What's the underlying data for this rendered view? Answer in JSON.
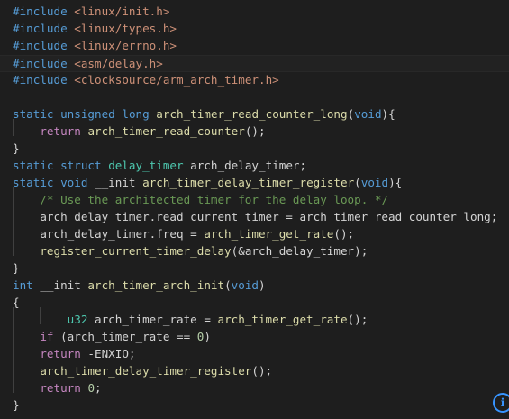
{
  "editor": {
    "lines": [
      {
        "tokens": [
          {
            "t": "#include",
            "c": "kw"
          },
          {
            "t": " ",
            "c": "pl"
          },
          {
            "t": "<linux/init.h>",
            "c": "str"
          }
        ]
      },
      {
        "tokens": [
          {
            "t": "#include",
            "c": "kw"
          },
          {
            "t": " ",
            "c": "pl"
          },
          {
            "t": "<linux/types.h>",
            "c": "str"
          }
        ]
      },
      {
        "tokens": [
          {
            "t": "#include",
            "c": "kw"
          },
          {
            "t": " ",
            "c": "pl"
          },
          {
            "t": "<linux/errno.h>",
            "c": "str"
          }
        ]
      },
      {
        "tokens": [
          {
            "t": "#include",
            "c": "kw"
          },
          {
            "t": " ",
            "c": "pl"
          },
          {
            "t": "<asm/delay.h>",
            "c": "str"
          }
        ],
        "current": true
      },
      {
        "tokens": [
          {
            "t": "#include",
            "c": "kw"
          },
          {
            "t": " ",
            "c": "pl"
          },
          {
            "t": "<clocksource/arm_arch_timer.h>",
            "c": "str"
          }
        ]
      },
      {
        "tokens": []
      },
      {
        "tokens": [
          {
            "t": "static",
            "c": "kw"
          },
          {
            "t": " ",
            "c": "pl"
          },
          {
            "t": "unsigned",
            "c": "kw"
          },
          {
            "t": " ",
            "c": "pl"
          },
          {
            "t": "long",
            "c": "kw"
          },
          {
            "t": " ",
            "c": "pl"
          },
          {
            "t": "arch_timer_read_counter_long",
            "c": "fn"
          },
          {
            "t": "(",
            "c": "pl"
          },
          {
            "t": "void",
            "c": "kw"
          },
          {
            "t": "){",
            "c": "pl"
          }
        ]
      },
      {
        "tokens": [
          {
            "t": "    ",
            "c": "pl"
          },
          {
            "t": "return",
            "c": "ctl"
          },
          {
            "t": " ",
            "c": "pl"
          },
          {
            "t": "arch_timer_read_counter",
            "c": "fn"
          },
          {
            "t": "();",
            "c": "pl"
          }
        ]
      },
      {
        "tokens": [
          {
            "t": "}",
            "c": "pl"
          }
        ]
      },
      {
        "tokens": [
          {
            "t": "static",
            "c": "kw"
          },
          {
            "t": " ",
            "c": "pl"
          },
          {
            "t": "struct",
            "c": "kw"
          },
          {
            "t": " ",
            "c": "pl"
          },
          {
            "t": "delay_timer",
            "c": "ty"
          },
          {
            "t": " arch_delay_timer;",
            "c": "pl"
          }
        ]
      },
      {
        "tokens": [
          {
            "t": "static",
            "c": "kw"
          },
          {
            "t": " ",
            "c": "pl"
          },
          {
            "t": "void",
            "c": "kw"
          },
          {
            "t": " __init ",
            "c": "pl"
          },
          {
            "t": "arch_timer_delay_timer_register",
            "c": "fn"
          },
          {
            "t": "(",
            "c": "pl"
          },
          {
            "t": "void",
            "c": "kw"
          },
          {
            "t": "){",
            "c": "pl"
          }
        ]
      },
      {
        "tokens": [
          {
            "t": "    ",
            "c": "pl"
          },
          {
            "t": "/* Use the architected timer for the delay loop. */",
            "c": "cm"
          }
        ]
      },
      {
        "tokens": [
          {
            "t": "    arch_delay_timer.read_current_timer = arch_timer_read_counter_long;",
            "c": "pl"
          }
        ]
      },
      {
        "tokens": [
          {
            "t": "    arch_delay_timer.freq = ",
            "c": "pl"
          },
          {
            "t": "arch_timer_get_rate",
            "c": "fn"
          },
          {
            "t": "();",
            "c": "pl"
          }
        ]
      },
      {
        "tokens": [
          {
            "t": "    ",
            "c": "pl"
          },
          {
            "t": "register_current_timer_delay",
            "c": "fn"
          },
          {
            "t": "(&arch_delay_timer);",
            "c": "pl"
          }
        ]
      },
      {
        "tokens": [
          {
            "t": "}",
            "c": "pl"
          }
        ]
      },
      {
        "tokens": [
          {
            "t": "int",
            "c": "kw"
          },
          {
            "t": " __init ",
            "c": "pl"
          },
          {
            "t": "arch_timer_arch_init",
            "c": "fn"
          },
          {
            "t": "(",
            "c": "pl"
          },
          {
            "t": "void",
            "c": "kw"
          },
          {
            "t": ")",
            "c": "pl"
          }
        ]
      },
      {
        "tokens": [
          {
            "t": "{",
            "c": "pl"
          }
        ]
      },
      {
        "tokens": [
          {
            "t": "        ",
            "c": "pl"
          },
          {
            "t": "u32",
            "c": "ty"
          },
          {
            "t": " arch_timer_rate = ",
            "c": "pl"
          },
          {
            "t": "arch_timer_get_rate",
            "c": "fn"
          },
          {
            "t": "();",
            "c": "pl"
          }
        ]
      },
      {
        "tokens": [
          {
            "t": "    ",
            "c": "pl"
          },
          {
            "t": "if",
            "c": "ctl"
          },
          {
            "t": " (arch_timer_rate == ",
            "c": "pl"
          },
          {
            "t": "0",
            "c": "num"
          },
          {
            "t": ")",
            "c": "pl"
          }
        ]
      },
      {
        "tokens": [
          {
            "t": "    ",
            "c": "pl"
          },
          {
            "t": "return",
            "c": "ctl"
          },
          {
            "t": " -ENXIO;",
            "c": "pl"
          }
        ]
      },
      {
        "tokens": [
          {
            "t": "    ",
            "c": "pl"
          },
          {
            "t": "arch_timer_delay_timer_register",
            "c": "fn"
          },
          {
            "t": "();",
            "c": "pl"
          }
        ]
      },
      {
        "tokens": [
          {
            "t": "    ",
            "c": "pl"
          },
          {
            "t": "return",
            "c": "ctl"
          },
          {
            "t": " ",
            "c": "pl"
          },
          {
            "t": "0",
            "c": "num"
          },
          {
            "t": ";",
            "c": "pl"
          }
        ]
      },
      {
        "tokens": [
          {
            "t": "}",
            "c": "pl"
          }
        ]
      }
    ]
  },
  "badge": {
    "glyph": "i",
    "icon": "info-icon",
    "color": "#3794ff"
  },
  "colors": {
    "background": "#1e1e1e",
    "keyword": "#569cd6",
    "control": "#c586c0",
    "string": "#ce9178",
    "function": "#dcdcaa",
    "number": "#b5cea8",
    "comment": "#6a9955",
    "type": "#4ec9b0",
    "text": "#d4d4d4"
  }
}
